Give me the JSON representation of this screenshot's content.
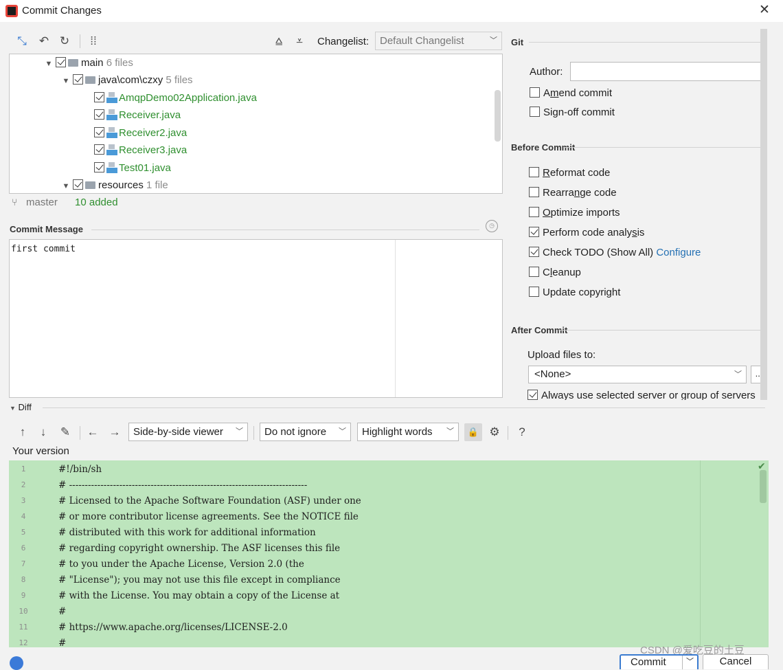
{
  "window": {
    "title": "Commit Changes",
    "close_glyph": "✕"
  },
  "toolbar": {
    "changelist_label": "Changelist:",
    "changelist_value": "Default Changelist"
  },
  "tree": {
    "rows": [
      {
        "label": "main",
        "count": "6 files",
        "type": "folder"
      },
      {
        "label": "java\\com\\czxy",
        "count": "5 files",
        "type": "folder"
      },
      {
        "label": "AmqpDemo02Application.java",
        "type": "file"
      },
      {
        "label": "Receiver.java",
        "type": "file"
      },
      {
        "label": "Receiver2.java",
        "type": "file"
      },
      {
        "label": "Receiver3.java",
        "type": "file"
      },
      {
        "label": "Test01.java",
        "type": "file"
      },
      {
        "label": "resources",
        "count": "1 file",
        "type": "folder"
      }
    ]
  },
  "status": {
    "branch": "master",
    "summary": "10 added"
  },
  "commit_message": {
    "title": "Commit Message",
    "text": "first commit"
  },
  "git": {
    "section": "Git",
    "author_label": "Author:",
    "author_value": "",
    "amend_pre": "A",
    "amend_ul": "m",
    "amend_post": "end commit",
    "signoff_pre": "Si",
    "signoff_ul": "g",
    "signoff_post": "n-off commit"
  },
  "before_commit": {
    "section": "Before Commit",
    "reformat_ul": "R",
    "reformat_post": "eformat code",
    "rearrange_pre": "Rearra",
    "rearrange_ul": "n",
    "rearrange_post": "ge code",
    "optimize_ul": "O",
    "optimize_post": "ptimize imports",
    "analysis_pre": "Perform code analy",
    "analysis_ul": "s",
    "analysis_post": "is",
    "todo_label": "Check TODO (Show All)",
    "todo_link": "Configure",
    "cleanup_pre": "C",
    "cleanup_ul": "l",
    "cleanup_post": "eanup",
    "copyright_label": "Update copyright"
  },
  "after_commit": {
    "section": "After Commit",
    "upload_label": "Upload files to:",
    "upload_value": "<None>",
    "upload_more": "...",
    "always_label": "Always use selected server or group of servers"
  },
  "diff": {
    "section": "Diff",
    "viewer": "Side-by-side viewer",
    "ignore": "Do not ignore",
    "highlight": "Highlight words",
    "help": "?",
    "version_label": "Your version",
    "lines": [
      {
        "n": "1",
        "t": "#!/bin/sh"
      },
      {
        "n": "2",
        "t": "# ----------------------------------------------------------------------------"
      },
      {
        "n": "3",
        "t": "# Licensed to the Apache Software Foundation (ASF) under one"
      },
      {
        "n": "4",
        "t": "# or more contributor license agreements.  See the NOTICE file"
      },
      {
        "n": "5",
        "t": "# distributed with this work for additional information"
      },
      {
        "n": "6",
        "t": "# regarding copyright ownership.  The ASF licenses this file"
      },
      {
        "n": "7",
        "t": "# to you under the Apache License, Version 2.0 (the"
      },
      {
        "n": "8",
        "t": "# \"License\"); you may not use this file except in compliance"
      },
      {
        "n": "9",
        "t": "# with the License.  You may obtain a copy of the License at"
      },
      {
        "n": "10",
        "t": "#"
      },
      {
        "n": "11",
        "t": "#    https://www.apache.org/licenses/LICENSE-2.0"
      },
      {
        "n": "12",
        "t": "#"
      }
    ]
  },
  "buttons": {
    "commit": "Commit",
    "cancel": "Cancel"
  },
  "watermark": "CSDN @爱吃豆的土豆"
}
